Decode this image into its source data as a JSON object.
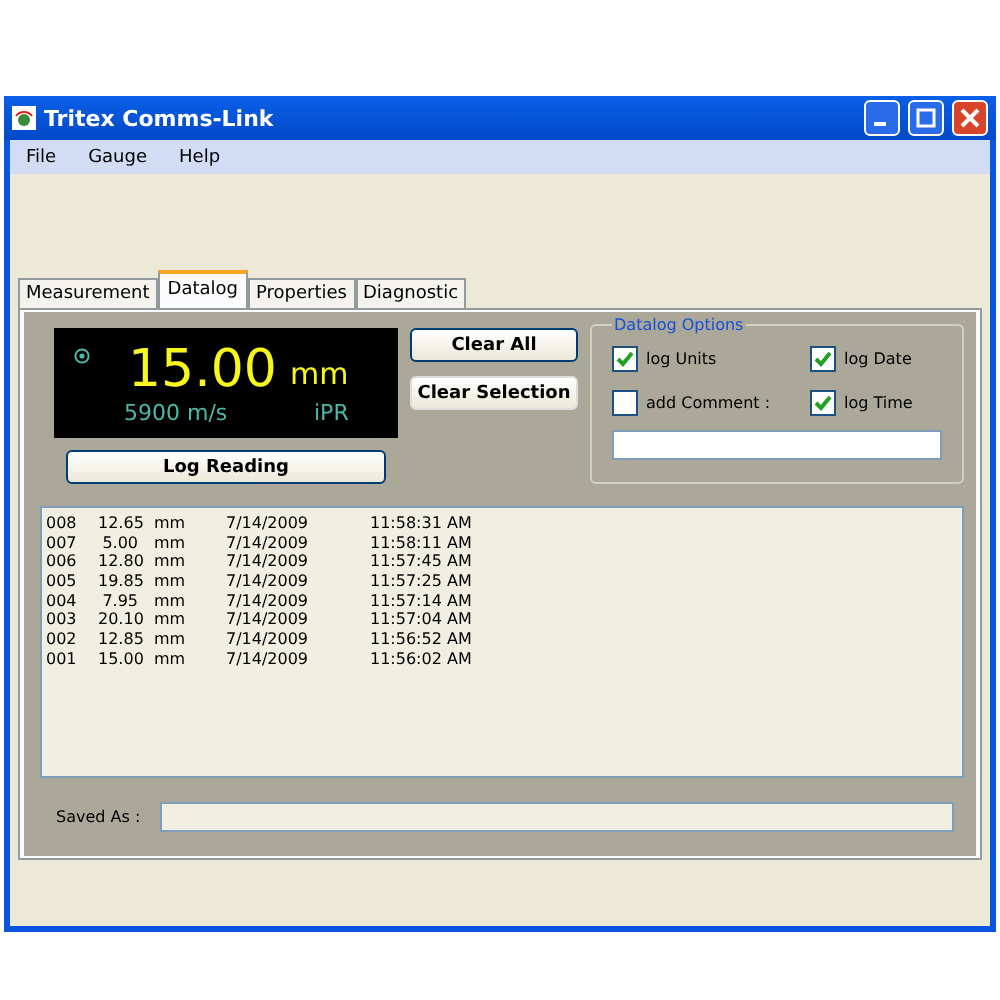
{
  "window": {
    "title": "Tritex Comms-Link"
  },
  "menu": [
    "File",
    "Gauge",
    "Help"
  ],
  "tabs": [
    {
      "label": "Measurement",
      "selected": false
    },
    {
      "label": "Datalog",
      "selected": true
    },
    {
      "label": "Properties",
      "selected": false
    },
    {
      "label": "Diagnostic",
      "selected": false
    }
  ],
  "display": {
    "reading": "15.00",
    "unit": "mm",
    "velocity": "5900 m/s",
    "mode": "iPR"
  },
  "buttons": {
    "log": "Log Reading",
    "clear_all": "Clear All",
    "clear_selection": "Clear Selection"
  },
  "options": {
    "title": "Datalog Options",
    "checks": [
      {
        "label": "log Units",
        "checked": true
      },
      {
        "label": "log Date",
        "checked": true
      },
      {
        "label": "add Comment :",
        "checked": false
      },
      {
        "label": "log Time",
        "checked": true
      }
    ]
  },
  "log_rows": [
    [
      "008",
      "12.65",
      "mm",
      "7/14/2009",
      "11:58:31 AM"
    ],
    [
      "007",
      "5.00",
      "mm",
      "7/14/2009",
      "11:58:11 AM"
    ],
    [
      "006",
      "12.80",
      "mm",
      "7/14/2009",
      "11:57:45 AM"
    ],
    [
      "005",
      "19.85",
      "mm",
      "7/14/2009",
      "11:57:25 AM"
    ],
    [
      "004",
      "7.95",
      "mm",
      "7/14/2009",
      "11:57:14 AM"
    ],
    [
      "003",
      "20.10",
      "mm",
      "7/14/2009",
      "11:57:04 AM"
    ],
    [
      "002",
      "12.85",
      "mm",
      "7/14/2009",
      "11:56:52 AM"
    ],
    [
      "001",
      "15.00",
      "mm",
      "7/14/2009",
      "11:56:02 AM"
    ]
  ],
  "saved_as": {
    "label": "Saved As :"
  }
}
